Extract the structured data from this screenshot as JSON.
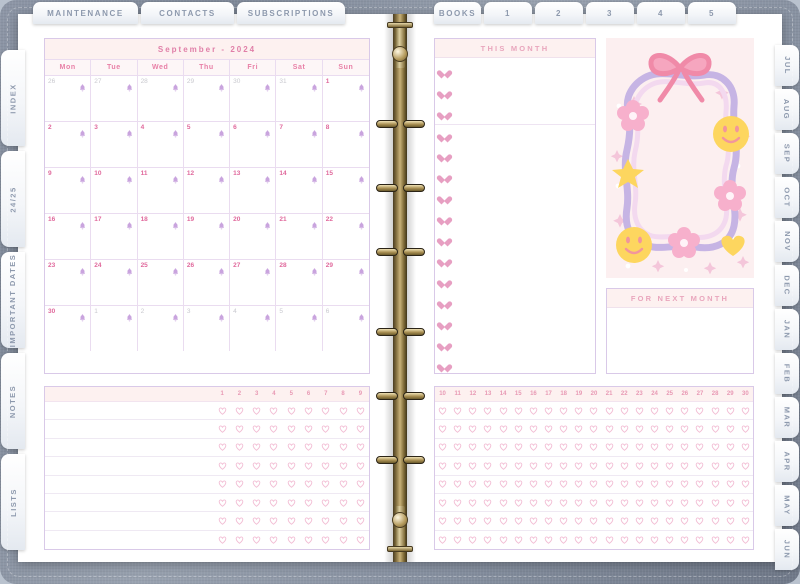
{
  "planner": {
    "type": "digital-planner-spread",
    "cover_color": "#8d96a6",
    "accent_pink": "#e87fa6",
    "accent_lilac": "#d9c9e8",
    "header_band": "#fdf1f0"
  },
  "top_tabs": [
    {
      "label": "MAINTENANCE"
    },
    {
      "label": "CONTACTS"
    },
    {
      "label": "SUBSCRIPTIONS"
    },
    {
      "label": "BOOKS"
    },
    {
      "label": "1"
    },
    {
      "label": "2"
    },
    {
      "label": "3"
    },
    {
      "label": "4"
    },
    {
      "label": "5"
    }
  ],
  "left_tabs": [
    {
      "label": "INDEX"
    },
    {
      "label": "24/25"
    },
    {
      "label": "IMPORTANT DATES"
    },
    {
      "label": "NOTES"
    },
    {
      "label": "LISTS"
    }
  ],
  "right_tabs": [
    {
      "label": "JUL"
    },
    {
      "label": "AUG"
    },
    {
      "label": "SEP"
    },
    {
      "label": "OCT"
    },
    {
      "label": "NOV"
    },
    {
      "label": "DEC"
    },
    {
      "label": "JAN"
    },
    {
      "label": "FEB"
    },
    {
      "label": "MAR"
    },
    {
      "label": "APR"
    },
    {
      "label": "MAY"
    },
    {
      "label": "JUN"
    }
  ],
  "calendar": {
    "title": "September - 2024",
    "weekdays": [
      "Mon",
      "Tue",
      "Wed",
      "Thu",
      "Fri",
      "Sat",
      "Sun"
    ],
    "weeks": [
      [
        {
          "day": "26",
          "muted": true
        },
        {
          "day": "27",
          "muted": true
        },
        {
          "day": "28",
          "muted": true
        },
        {
          "day": "29",
          "muted": true
        },
        {
          "day": "30",
          "muted": true
        },
        {
          "day": "31",
          "muted": true
        },
        {
          "day": "1",
          "muted": false
        }
      ],
      [
        {
          "day": "2",
          "muted": false
        },
        {
          "day": "3",
          "muted": false
        },
        {
          "day": "4",
          "muted": false
        },
        {
          "day": "5",
          "muted": false
        },
        {
          "day": "6",
          "muted": false
        },
        {
          "day": "7",
          "muted": false
        },
        {
          "day": "8",
          "muted": false
        }
      ],
      [
        {
          "day": "9",
          "muted": false
        },
        {
          "day": "10",
          "muted": false
        },
        {
          "day": "11",
          "muted": false
        },
        {
          "day": "12",
          "muted": false
        },
        {
          "day": "13",
          "muted": false
        },
        {
          "day": "14",
          "muted": false
        },
        {
          "day": "15",
          "muted": false
        }
      ],
      [
        {
          "day": "16",
          "muted": false
        },
        {
          "day": "17",
          "muted": false
        },
        {
          "day": "18",
          "muted": false
        },
        {
          "day": "19",
          "muted": false
        },
        {
          "day": "20",
          "muted": false
        },
        {
          "day": "21",
          "muted": false
        },
        {
          "day": "22",
          "muted": false
        }
      ],
      [
        {
          "day": "23",
          "muted": false
        },
        {
          "day": "24",
          "muted": false
        },
        {
          "day": "25",
          "muted": false
        },
        {
          "day": "26",
          "muted": false
        },
        {
          "day": "27",
          "muted": false
        },
        {
          "day": "28",
          "muted": false
        },
        {
          "day": "29",
          "muted": false
        }
      ],
      [
        {
          "day": "30",
          "muted": false
        },
        {
          "day": "1",
          "muted": true
        },
        {
          "day": "2",
          "muted": true
        },
        {
          "day": "3",
          "muted": true
        },
        {
          "day": "4",
          "muted": true
        },
        {
          "day": "5",
          "muted": true
        },
        {
          "day": "6",
          "muted": true
        }
      ]
    ],
    "cell_icon": "bell-icon"
  },
  "this_month": {
    "title": "THIS MONTH",
    "bullet_icon": "heart-filled-icon",
    "items": [
      "",
      "",
      "",
      "",
      "",
      "",
      "",
      "",
      "",
      "",
      "",
      "",
      "",
      "",
      ""
    ],
    "divider_after_index": 2
  },
  "next_month": {
    "title": "FOR NEXT MONTH",
    "value": ""
  },
  "sticker_frame": {
    "name": "decorative-sticker-frame",
    "background": "#fceff0",
    "elements": [
      {
        "icon": "bow-icon",
        "color": "#f08aa8"
      },
      {
        "icon": "flower-icon",
        "color": "#f7b0cc"
      },
      {
        "icon": "flower-icon",
        "color": "#f7b0cc"
      },
      {
        "icon": "flower-icon",
        "color": "#f7b0cc"
      },
      {
        "icon": "smiley-icon",
        "color": "#fdd65f"
      },
      {
        "icon": "smiley-icon",
        "color": "#fdd65f"
      },
      {
        "icon": "star-icon",
        "color": "#fdd65f"
      },
      {
        "icon": "heart-icon",
        "color": "#fdd65f"
      },
      {
        "icon": "sparkle-icon",
        "color": "#f4c6da"
      }
    ],
    "border_color": "#c6b4e4"
  },
  "habit_tracker_left": {
    "columns": [
      "1",
      "2",
      "3",
      "4",
      "5",
      "6",
      "7",
      "8",
      "9"
    ],
    "row_count": 8,
    "cell_icon": "heart-outline-icon",
    "labels": [
      "",
      "",
      "",
      "",
      "",
      "",
      "",
      ""
    ]
  },
  "habit_tracker_right": {
    "columns": [
      "10",
      "11",
      "12",
      "13",
      "14",
      "15",
      "16",
      "17",
      "18",
      "19",
      "20",
      "21",
      "22",
      "23",
      "24",
      "25",
      "26",
      "27",
      "28",
      "29",
      "30"
    ],
    "row_count": 8,
    "cell_icon": "heart-outline-icon"
  },
  "rings": {
    "count": 6,
    "color": "#c8b179",
    "clasp_icon": "binder-clasp-icon"
  }
}
